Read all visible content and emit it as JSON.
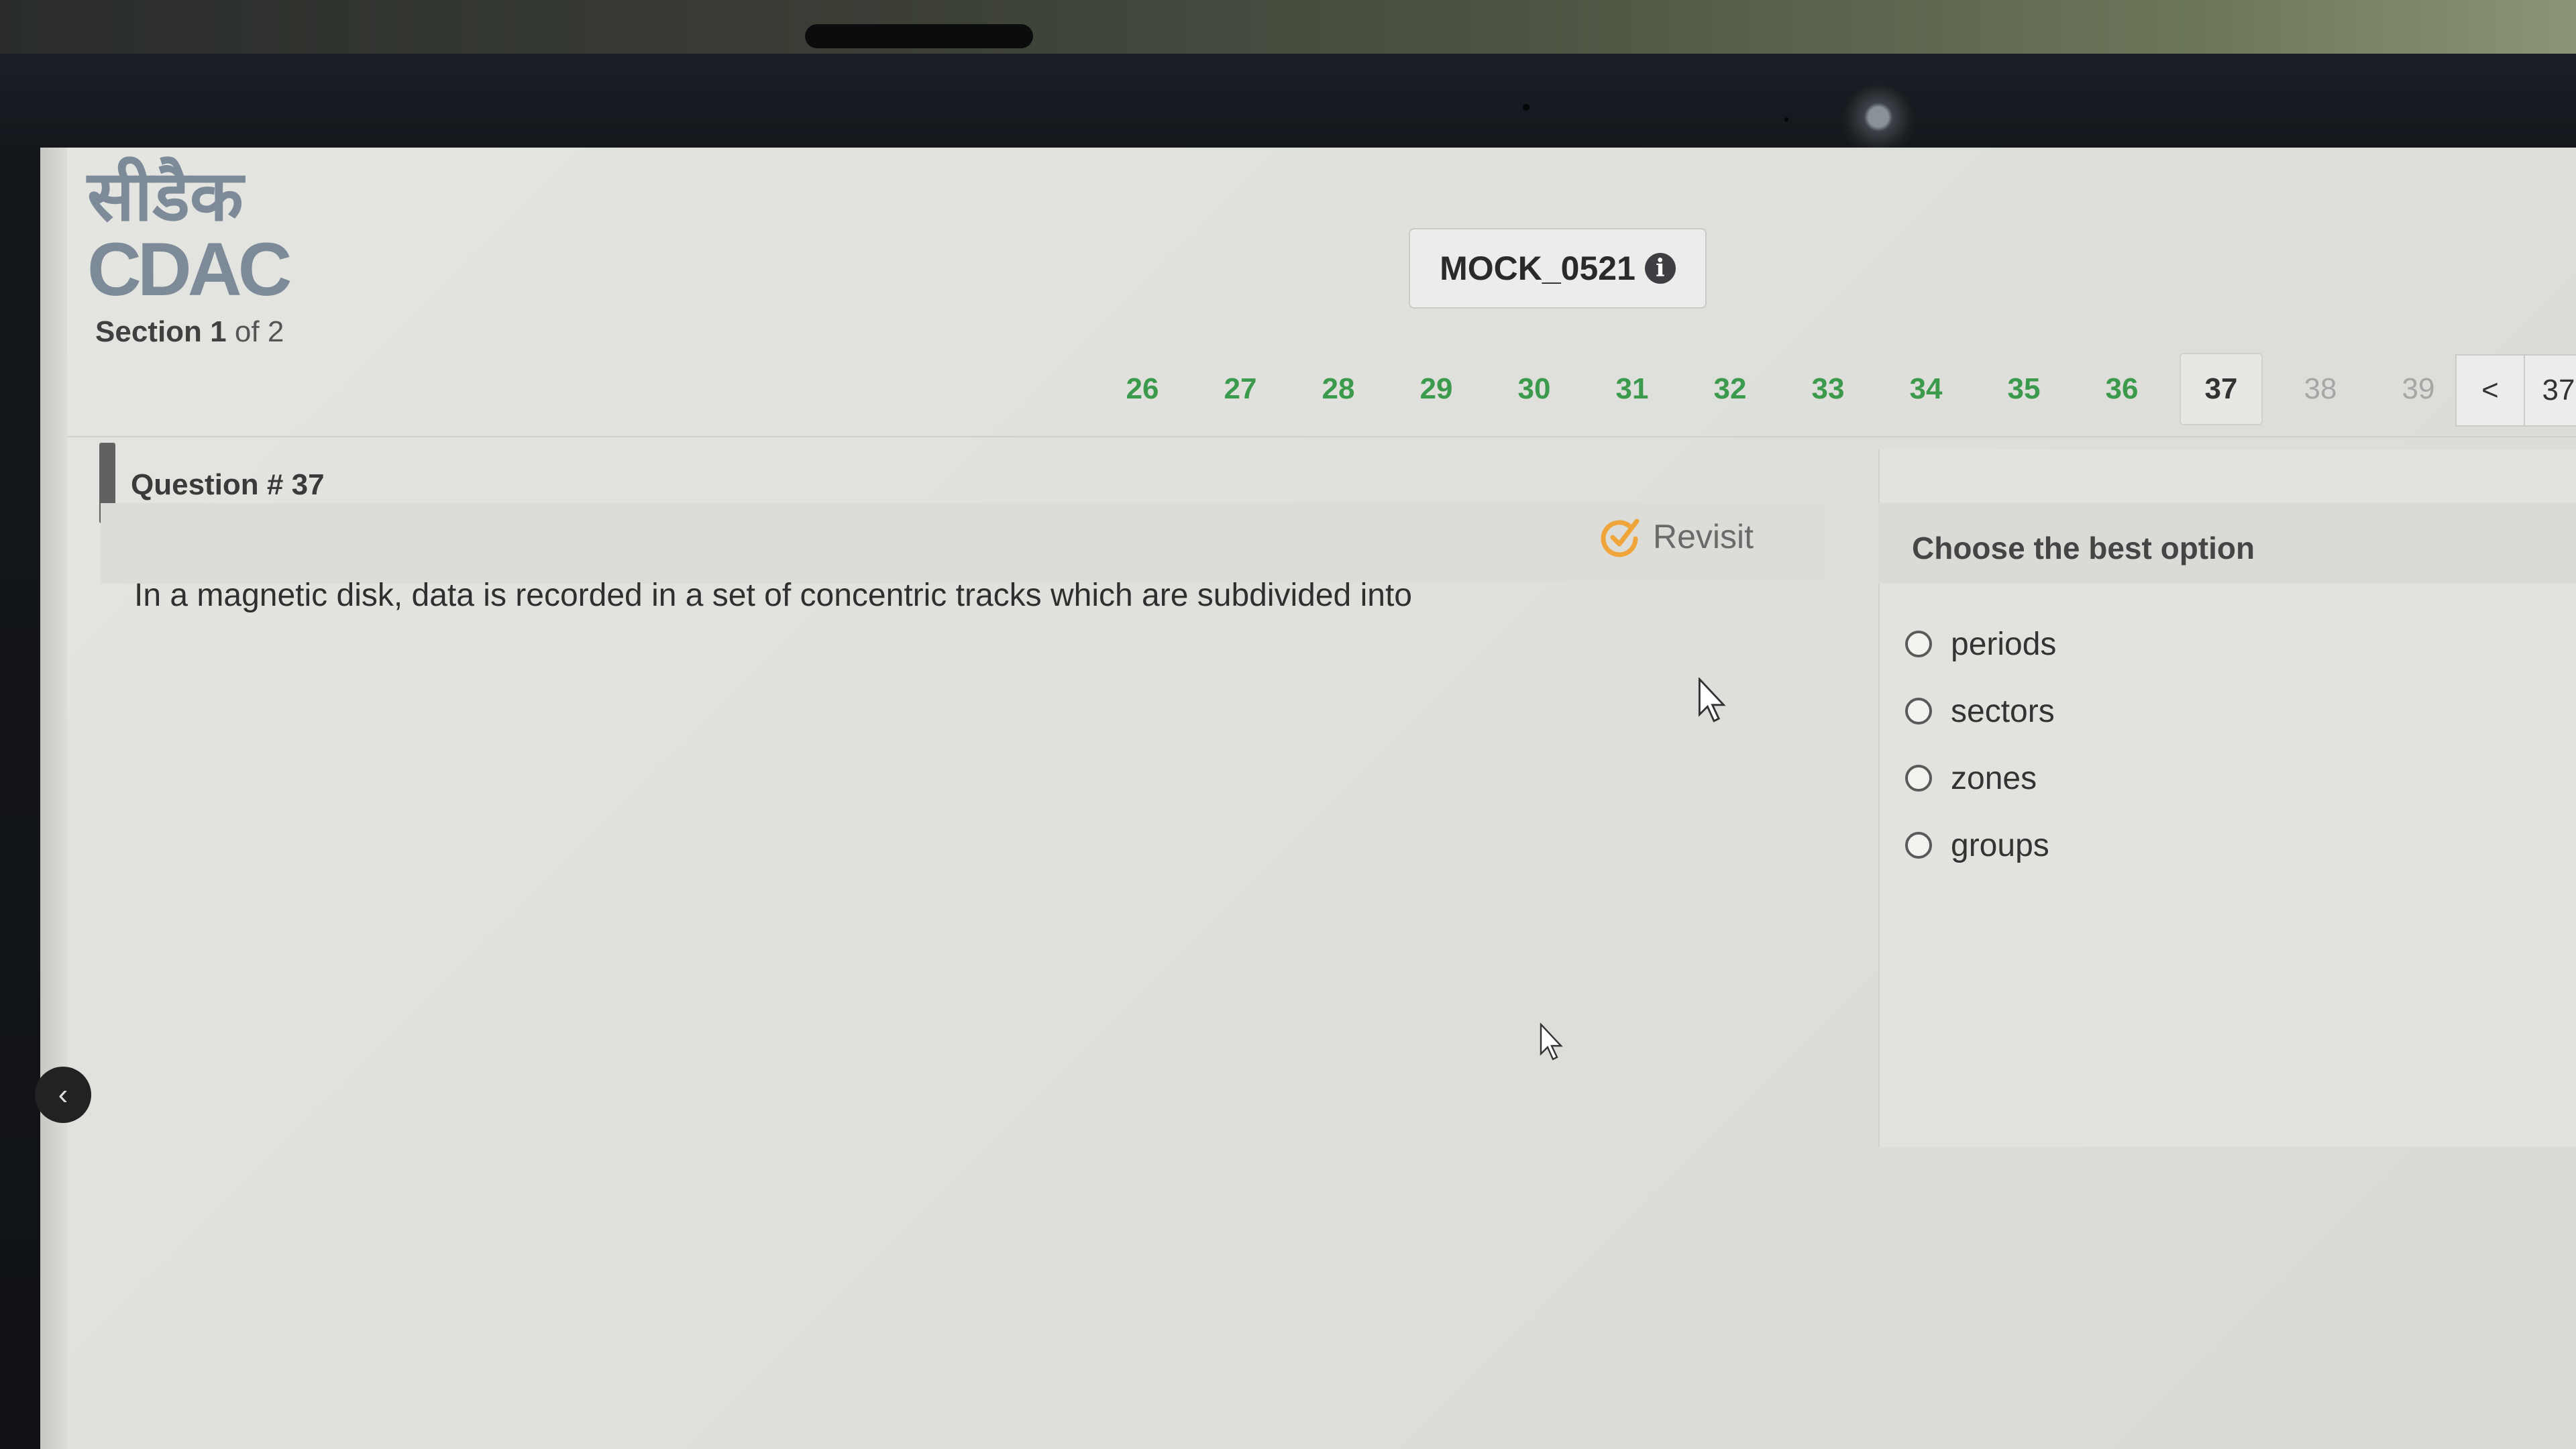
{
  "logo": {
    "hindi": "सीडैक",
    "text": "CDAC"
  },
  "section": {
    "label": "Section",
    "current": "1",
    "of_label": "of",
    "total": "2"
  },
  "test": {
    "id": "MOCK_0521",
    "info_icon": "info-icon"
  },
  "question_nav": {
    "numbers": [
      "26",
      "27",
      "28",
      "29",
      "30",
      "31",
      "32",
      "33",
      "34",
      "35",
      "36",
      "37",
      "38",
      "39"
    ],
    "current": "37",
    "pager_prev": "<",
    "pager_current": "37",
    "colors": {
      "answered": "#3b9a4c",
      "unvisited": "#a6a6a6"
    }
  },
  "question": {
    "title": "Question # 37",
    "revisit_label": "Revisit",
    "revisit_icon": "revisit-icon",
    "text": "In a magnetic disk, data is recorded in a set of concentric tracks which are subdivided into"
  },
  "options": {
    "title": "Choose the best option",
    "items": [
      "periods",
      "sectors",
      "zones",
      "groups"
    ]
  },
  "back_button_icon": "chevron-left-icon"
}
